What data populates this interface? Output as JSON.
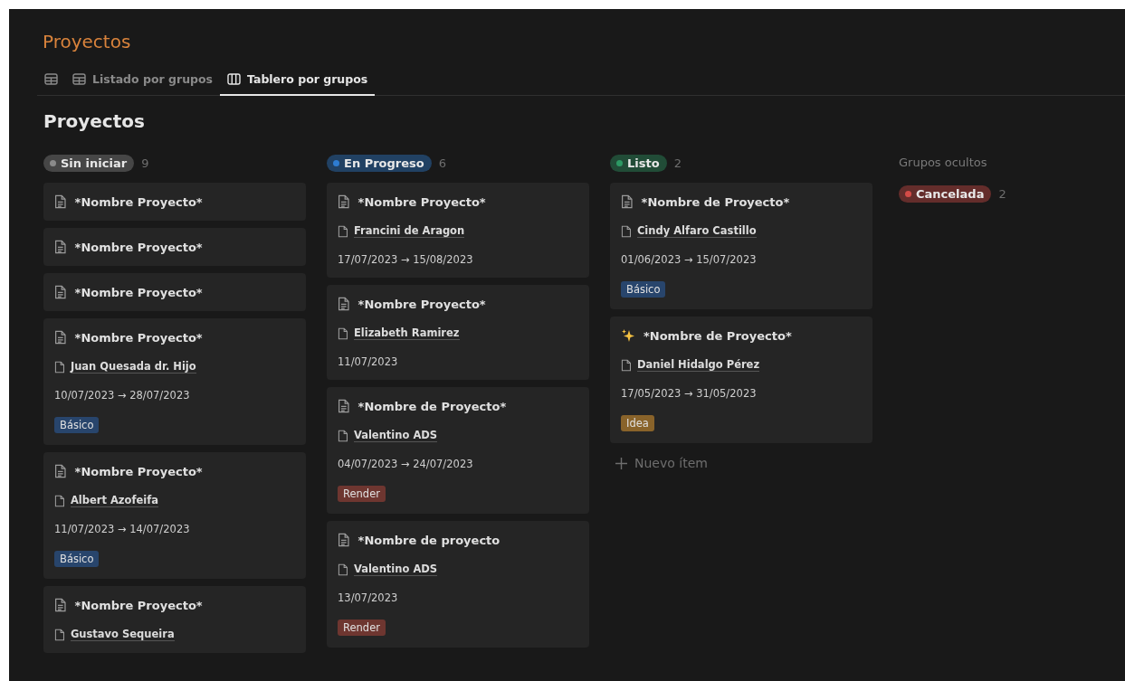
{
  "page_title": "Proyectos",
  "tabs": [
    {
      "kind": "table",
      "selected": false
    },
    {
      "kind": "table",
      "label": "Listado por grupos",
      "selected": false
    },
    {
      "kind": "board",
      "label": "Tablero por grupos",
      "selected": true
    }
  ],
  "view_title": "Proyectos",
  "groups": [
    {
      "name": "Sin iniciar",
      "color": "#8a8a8a",
      "count": "9",
      "cards": [
        {
          "kind": "page",
          "title": "*Nombre Proyecto*"
        },
        {
          "kind": "page",
          "title": "*Nombre Proyecto*"
        },
        {
          "kind": "page",
          "title": "*Nombre Proyecto*"
        },
        {
          "kind": "page",
          "title": "*Nombre Proyecto*",
          "person": "Juan Quesada dr. Hijo",
          "dates": "10/07/2023 → 28/07/2023",
          "tag": {
            "label": "Básico",
            "color": "#28456c"
          }
        },
        {
          "kind": "page",
          "title": "*Nombre Proyecto*",
          "person": "Albert Azofeifa",
          "dates": "11/07/2023 → 14/07/2023",
          "tag": {
            "label": "Básico",
            "color": "#28456c"
          }
        },
        {
          "kind": "page",
          "title": "*Nombre Proyecto*",
          "person": "Gustavo Sequeira"
        }
      ]
    },
    {
      "name": "En Progreso",
      "color": "#2e7cd1",
      "count": "6",
      "cards": [
        {
          "kind": "page",
          "title": "*Nombre Proyecto*",
          "person": "Francini de Aragon",
          "dates": "17/07/2023 → 15/08/2023"
        },
        {
          "kind": "page",
          "title": "*Nombre Proyecto*",
          "person": "Elizabeth Ramirez",
          "dates": "11/07/2023"
        },
        {
          "kind": "page",
          "title": "*Nombre de Proyecto*",
          "person": "Valentino ADS",
          "dates": "04/07/2023 → 24/07/2023",
          "tag": {
            "label": "Render",
            "color": "#6e3630"
          }
        },
        {
          "kind": "page",
          "title": "*Nombre de proyecto",
          "person": "Valentino ADS",
          "dates": "13/07/2023",
          "tag": {
            "label": "Render",
            "color": "#6e3630"
          }
        }
      ]
    },
    {
      "name": "Listo",
      "color": "#2d9964",
      "count": "2",
      "new_item": "Nuevo ítem",
      "cards": [
        {
          "kind": "page",
          "title": "*Nombre de Proyecto*",
          "person": "Cindy Alfaro Castillo",
          "dates": "01/06/2023 → 15/07/2023",
          "tag": {
            "label": "Básico",
            "color": "#28456c"
          }
        },
        {
          "kind": "sparkles",
          "title": "*Nombre de Proyecto*",
          "person": "Daniel Hidalgo Pérez",
          "dates": "17/05/2023 → 31/05/2023",
          "tag": {
            "label": "Idea",
            "color": "#89632a"
          }
        }
      ]
    }
  ],
  "hidden_groups": {
    "title": "Grupos ocultos",
    "groups": [
      {
        "name": "Cancelada",
        "color": "#d44c47",
        "count": "2"
      }
    ]
  }
}
